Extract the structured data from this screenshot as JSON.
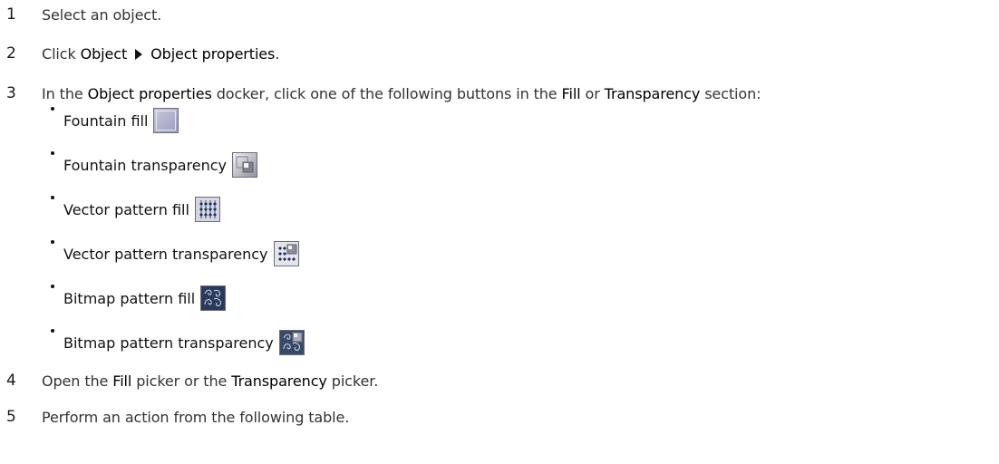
{
  "steps": [
    {
      "number": "1",
      "text": "Select an object."
    },
    {
      "number": "2",
      "prefix": "Click ",
      "menu_a": "Object",
      "menu_b": "Object properties",
      "suffix": "."
    },
    {
      "number": "3",
      "t1": "In the ",
      "b1": "Object properties",
      "t2": " docker, click one of the following buttons in the ",
      "b2": "Fill",
      "t3": " or ",
      "b3": "Transparency",
      "t4": " section:"
    },
    {
      "number": "4",
      "t1": "Open the ",
      "b1": "Fill",
      "t2": " picker or the ",
      "b2": "Transparency",
      "t3": " picker."
    },
    {
      "number": "5",
      "text": "Perform an action from the following table."
    }
  ],
  "buttons": [
    {
      "label": "Fountain fill",
      "icon": "fountain-fill-icon"
    },
    {
      "label": "Fountain transparency",
      "icon": "fountain-transparency-icon"
    },
    {
      "label": "Vector pattern fill",
      "icon": "vector-pattern-fill-icon"
    },
    {
      "label": "Vector pattern transparency",
      "icon": "vector-pattern-transparency-icon"
    },
    {
      "label": "Bitmap pattern fill",
      "icon": "bitmap-pattern-fill-icon"
    },
    {
      "label": "Bitmap pattern transparency",
      "icon": "bitmap-pattern-transparency-icon"
    }
  ]
}
